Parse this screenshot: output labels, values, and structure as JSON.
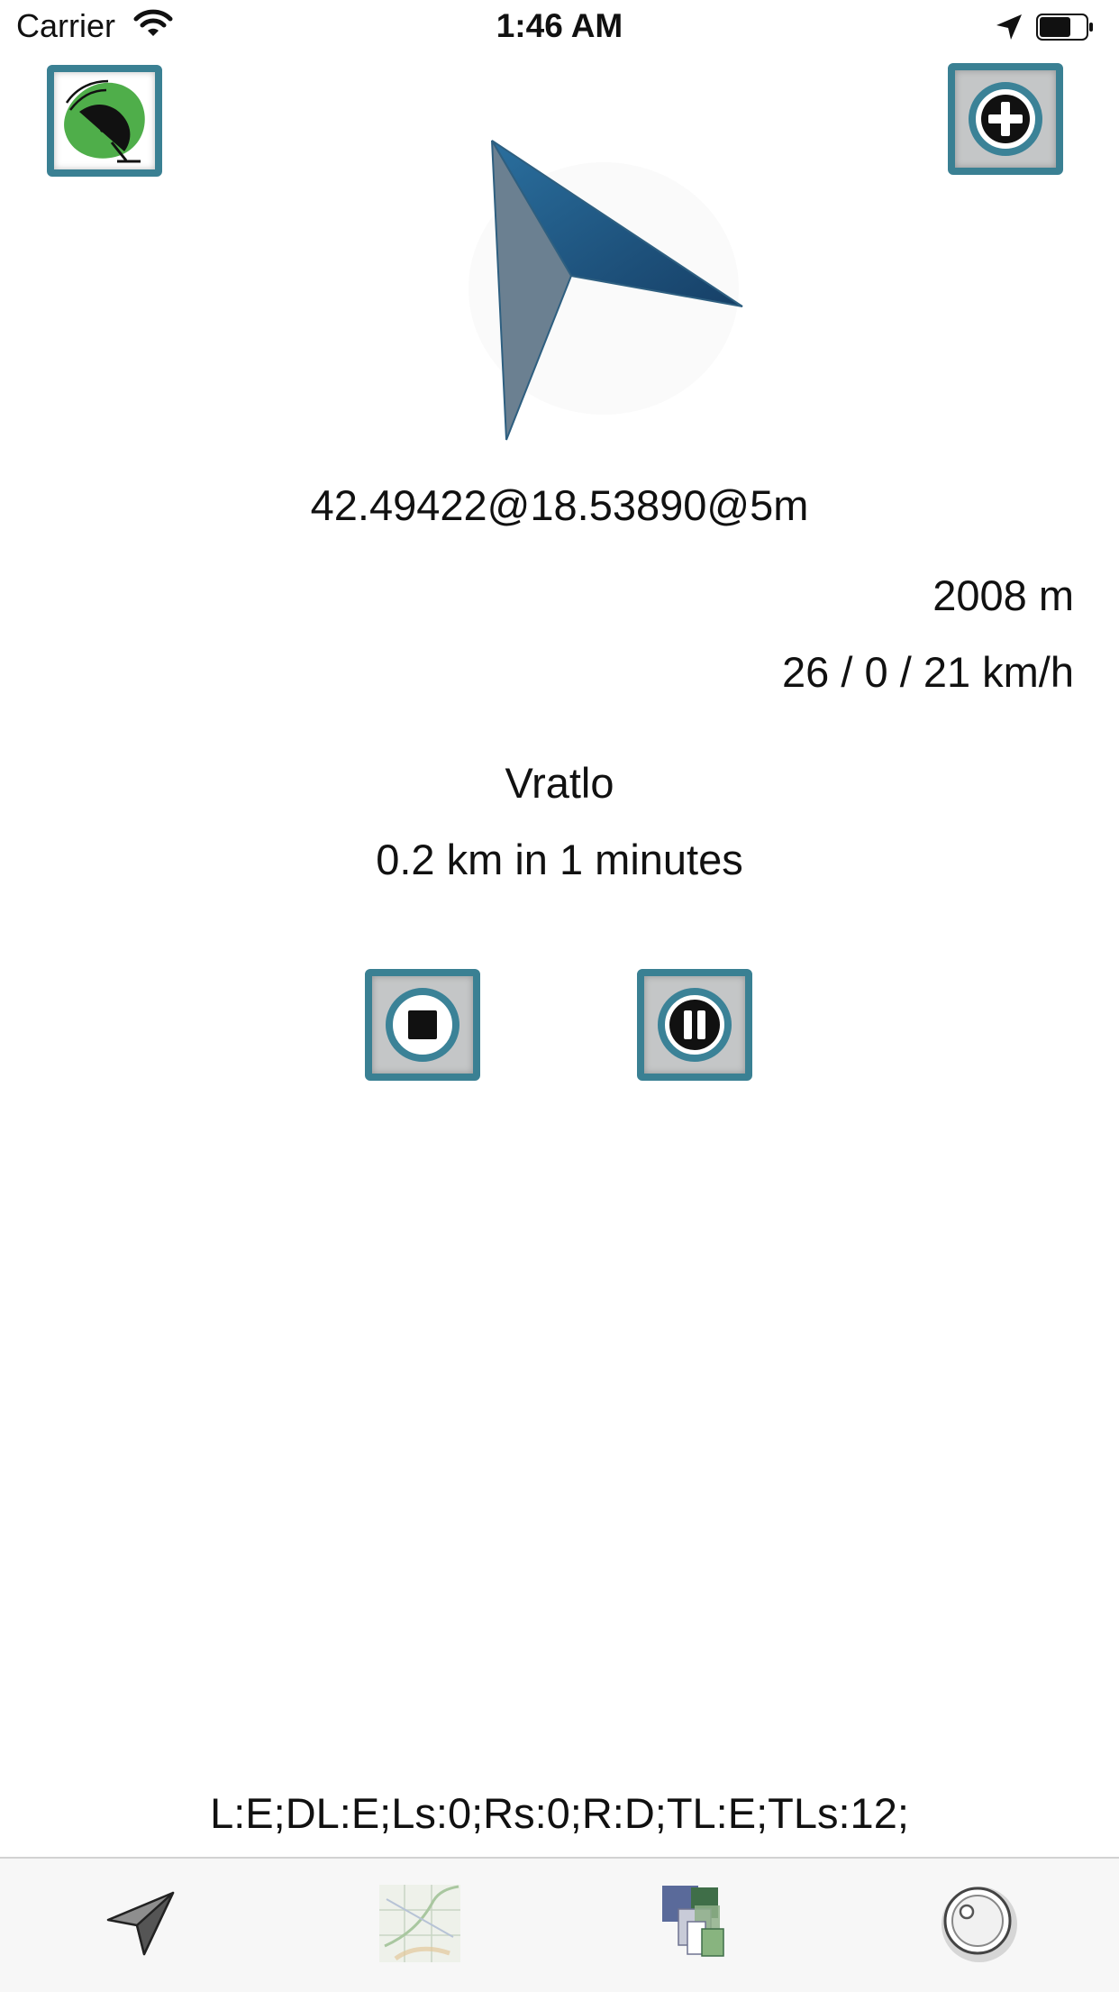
{
  "status_bar": {
    "carrier": "Carrier",
    "time": "1:46 AM"
  },
  "buttons": {
    "satellite_icon": "satellite-dish-icon",
    "add_icon": "plus-icon",
    "stop_icon": "stop-icon",
    "pause_icon": "pause-icon"
  },
  "location": {
    "coordinates": "42.49422@18.53890@5m",
    "altitude": "2008 m",
    "speed": "26 / 0 / 21 km/h"
  },
  "destination": {
    "name": "Vratlo",
    "eta": "0.2 km in 1 minutes"
  },
  "debug": {
    "status": "L:E;DL:E;Ls:0;Rs:0;R:D;TL:E;TLs:12;"
  },
  "tab_bar": {
    "items": [
      {
        "icon": "navigation-arrow-icon"
      },
      {
        "icon": "map-icon"
      },
      {
        "icon": "layers-icon"
      },
      {
        "icon": "settings-knob-icon"
      }
    ]
  },
  "colors": {
    "accent": "#3a8093",
    "arrow_dark": "#1f5c84",
    "arrow_light": "#6b8091",
    "button_bg": "#c4c6c7"
  }
}
